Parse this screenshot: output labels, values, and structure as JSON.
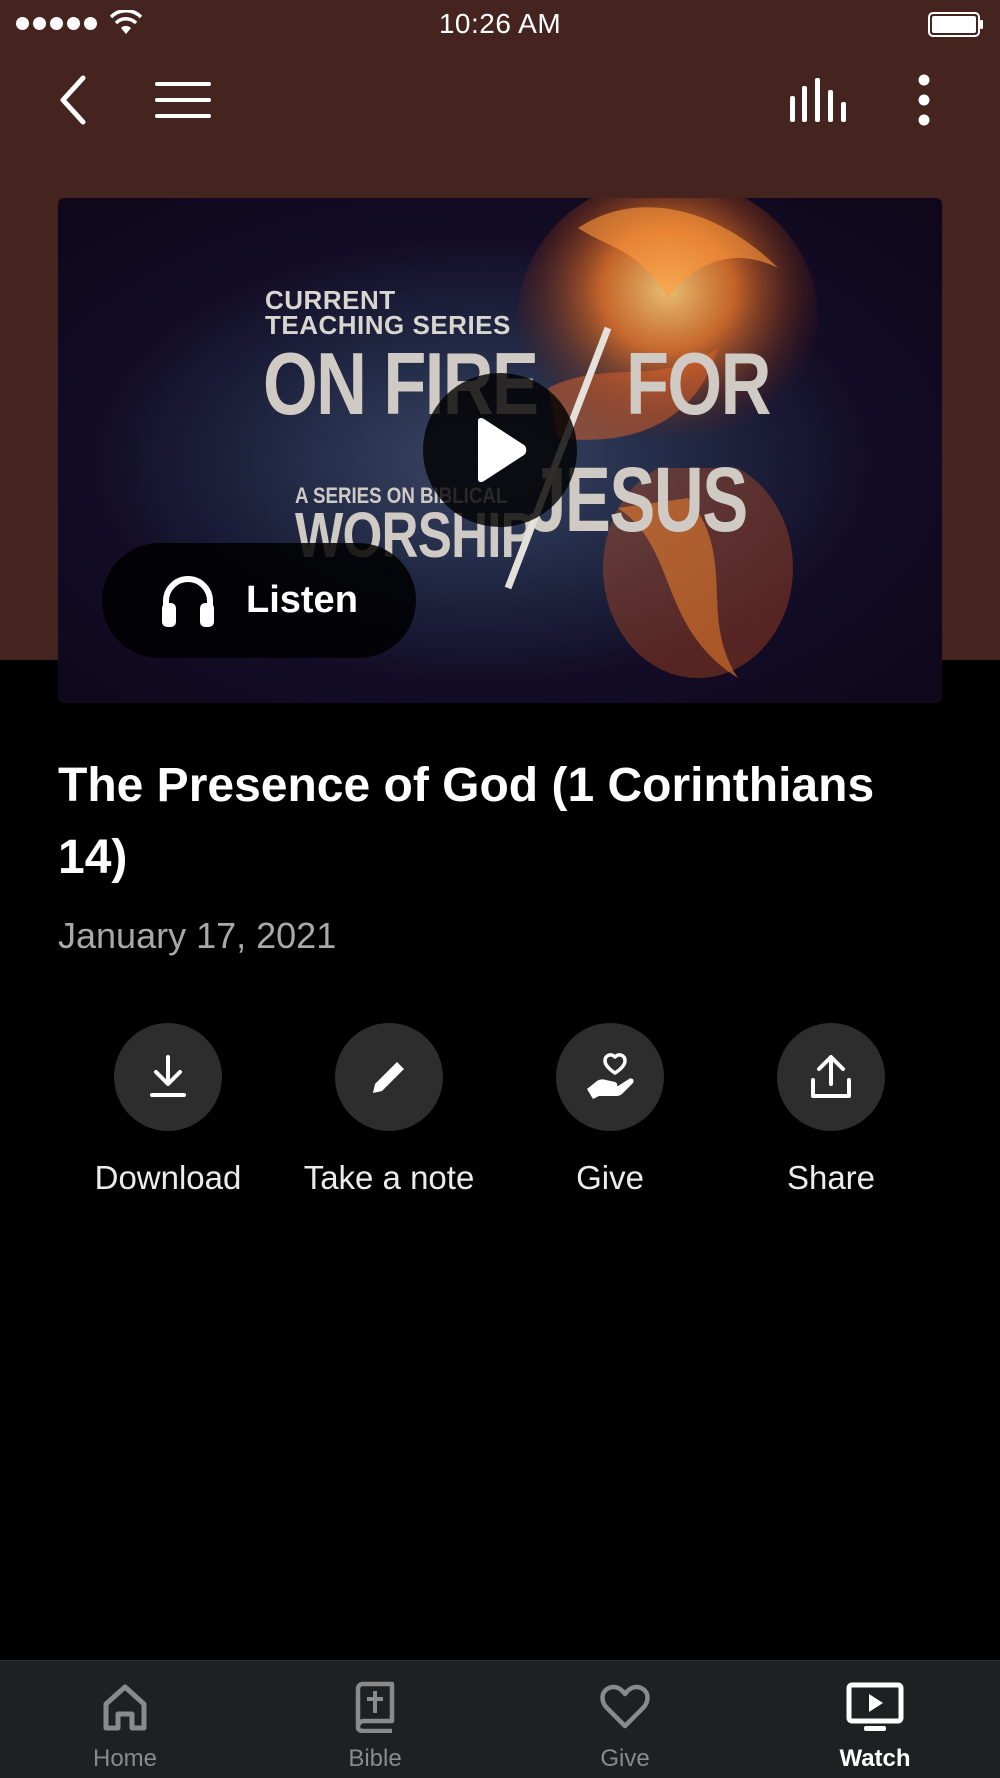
{
  "status_bar": {
    "time": "10:26 AM",
    "icons": [
      "signal-icon",
      "wifi-icon",
      "battery-icon"
    ]
  },
  "nav": {
    "icons": [
      "back-icon",
      "menu-icon",
      "audio-levels-icon",
      "more-vertical-icon"
    ]
  },
  "hero": {
    "artwork_text": {
      "line1": "CURRENT",
      "line2": "TEACHING SERIES",
      "line3a": "ON FIRE",
      "line3b": "FOR",
      "line4": "A SERIES ON BIBLICAL",
      "line5a": "WORSHIP",
      "line5b": "JESUS"
    },
    "play_icon": "play-icon",
    "listen_label": "Listen",
    "listen_icon": "headphones-icon"
  },
  "content": {
    "title": "The Presence of God (1 Corinthians 14)",
    "date": "January 17, 2021"
  },
  "actions": [
    {
      "label": "Download",
      "icon": "download-icon"
    },
    {
      "label": "Take a note",
      "icon": "pencil-icon"
    },
    {
      "label": "Give",
      "icon": "hand-heart-icon"
    },
    {
      "label": "Share",
      "icon": "share-icon"
    }
  ],
  "tab_bar": {
    "tabs": [
      {
        "label": "Home",
        "icon": "home-icon",
        "active": false
      },
      {
        "label": "Bible",
        "icon": "bible-icon",
        "active": false
      },
      {
        "label": "Give",
        "icon": "heart-icon",
        "active": false
      },
      {
        "label": "Watch",
        "icon": "tv-play-icon",
        "active": true
      }
    ]
  },
  "colors": {
    "header_bg": "#45231f",
    "body_bg": "#000000",
    "action_circle": "#2d2d2d",
    "tab_bar_bg": "#1f2021",
    "inactive_tab": "#8a8a8a",
    "date_text": "#a9a9a9"
  }
}
